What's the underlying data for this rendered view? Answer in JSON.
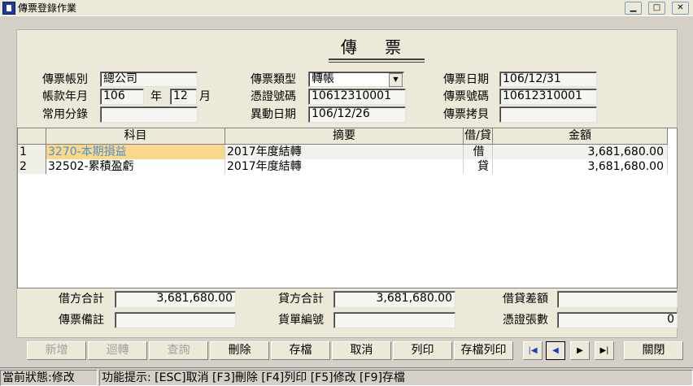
{
  "window": {
    "title": "傳票登錄作業"
  },
  "form": {
    "title": "傳 票",
    "account_type": {
      "label": "傳票帳別",
      "value": "總公司"
    },
    "period": {
      "label": "帳款年月",
      "year": "106",
      "year_unit": "年",
      "month": "12",
      "month_unit": "月"
    },
    "common_category": {
      "label": "常用分錄",
      "value": ""
    },
    "voucher_type": {
      "label": "傳票類型",
      "value": "轉帳"
    },
    "certificate_no": {
      "label": "憑證號碼",
      "value": "10612310001"
    },
    "change_date": {
      "label": "異動日期",
      "value": "106/12/26"
    },
    "voucher_date": {
      "label": "傳票日期",
      "value": "106/12/31"
    },
    "voucher_no": {
      "label": "傳票號碼",
      "value": "10612310001"
    },
    "voucher_copy": {
      "label": "傳票拷貝",
      "value": ""
    }
  },
  "grid": {
    "columns": [
      "科目",
      "摘要",
      "借/貸",
      "金額"
    ],
    "rows": [
      {
        "num": "1",
        "account": "3270-本期損益",
        "memo": "2017年度結轉",
        "dc": "借",
        "amount": "3,681,680.00",
        "selected": true
      },
      {
        "num": "2",
        "account": "32502-累積盈虧",
        "memo": "2017年度結轉",
        "dc": "貸",
        "amount": "3,681,680.00",
        "selected": false
      }
    ]
  },
  "totals": {
    "debit_total": {
      "label": "借方合計",
      "value": "3,681,680.00"
    },
    "credit_total": {
      "label": "貸方合計",
      "value": "3,681,680.00"
    },
    "difference": {
      "label": "借貸差額",
      "value": ""
    },
    "remark": {
      "label": "傳票備註",
      "value": ""
    },
    "bill_no": {
      "label": "貨單編號",
      "value": ""
    },
    "cert_count": {
      "label": "憑證張數",
      "value": "0"
    }
  },
  "toolbar": {
    "add": "新增",
    "reverse": "迴轉",
    "query": "查詢",
    "delete": "刪除",
    "save": "存檔",
    "cancel": "取消",
    "print": "列印",
    "save_print": "存檔列印",
    "close": "關閉"
  },
  "status": {
    "state": "當前狀態:修改",
    "hint": "功能提示: [ESC]取消 [F3]刪除 [F4]列印 [F5]修改 [F9]存檔"
  },
  "colors": {
    "selected_cell_bg": "#f9d88c",
    "selected_text": "#4a8fd8",
    "nav_arrow": "#1a3cd0"
  }
}
